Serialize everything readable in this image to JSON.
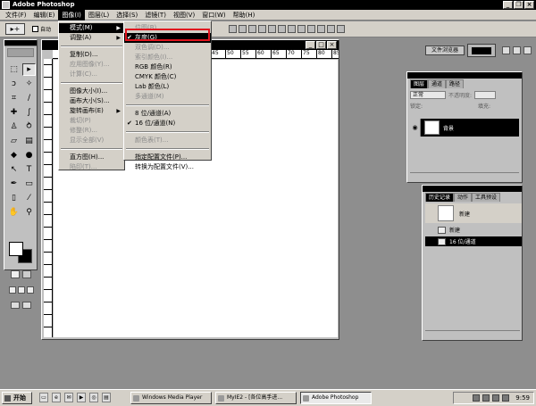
{
  "app": {
    "title": "Adobe Photoshop"
  },
  "menubar": {
    "items": [
      "文件(F)",
      "编辑(E)",
      "图像(I)",
      "图层(L)",
      "选择(S)",
      "滤镜(T)",
      "视图(V)",
      "窗口(W)",
      "帮助(H)"
    ],
    "active_index": 2
  },
  "options": {
    "tool_glyph": "▸+",
    "auto_label": "自动",
    "file_browser": "文件浏览器"
  },
  "image_menu": {
    "items": [
      {
        "label": "模式(M)",
        "state": "highlighted",
        "submenu": true
      },
      {
        "label": "调整(A)",
        "submenu": true
      },
      {
        "label": "复制(D)..."
      },
      {
        "label": "应用图像(Y)...",
        "disabled": true
      },
      {
        "label": "计算(C)...",
        "disabled": true
      },
      {
        "label": "图像大小(I)..."
      },
      {
        "label": "画布大小(S)..."
      },
      {
        "label": "旋转画布(E)",
        "submenu": true
      },
      {
        "label": "裁切(P)",
        "disabled": true
      },
      {
        "label": "修整(R)...",
        "disabled": true
      },
      {
        "label": "显示全部(V)",
        "disabled": true
      },
      {
        "label": "直方图(H)..."
      },
      {
        "label": "陷印(T)...",
        "disabled": true
      }
    ]
  },
  "mode_submenu": {
    "items": [
      {
        "label": "位图(B)...",
        "disabled": true
      },
      {
        "label": "灰度(G)",
        "checked": true,
        "state": "highlighted"
      },
      {
        "label": "双色调(D)...",
        "disabled": true
      },
      {
        "label": "索引颜色(I)...",
        "disabled": true
      },
      {
        "label": "RGB 颜色(R)"
      },
      {
        "label": "CMYK 颜色(C)"
      },
      {
        "label": "Lab 颜色(L)"
      },
      {
        "label": "多通道(M)",
        "disabled": true
      },
      {
        "label": "8 位/通道(A)"
      },
      {
        "label": "16 位/通道(N)",
        "checked": true
      },
      {
        "label": "颜色表(T)...",
        "disabled": true
      },
      {
        "label": "指定配置文件(P)..."
      },
      {
        "label": "转换为配置文件(V)..."
      }
    ]
  },
  "ruler": {
    "top_ticks": [
      "45",
      "50",
      "55",
      "60",
      "65",
      "70",
      "75",
      "80",
      "85",
      "90"
    ]
  },
  "layers_palette": {
    "tabs": [
      "图层",
      "通道",
      "路径"
    ],
    "blend_mode": "正常",
    "opacity_label": "不透明度:",
    "lock_label": "锁定:",
    "fill_label": "填充:",
    "layer_name": "背景"
  },
  "history_palette": {
    "tabs": [
      "历史记录",
      "动作",
      "工具预设"
    ],
    "snapshot_name": "新建",
    "rows": [
      "新建",
      "16 位/通道"
    ]
  },
  "taskbar": {
    "start_label": "开始",
    "tasks": [
      "Windows Media Player",
      "MyIE2 - [各位高手进...",
      "Adobe Photoshop"
    ],
    "clock": "9:59"
  },
  "colors": {
    "highlight_box": "#e0141e",
    "titlebar": "#000000",
    "workspace": "#8e8e8e"
  }
}
